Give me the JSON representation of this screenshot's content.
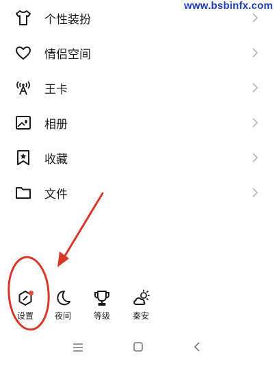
{
  "watermark": "www.bsbinfx.com",
  "menu": {
    "items": [
      {
        "label": "个性装扮",
        "icon": "tshirt-icon"
      },
      {
        "label": "情侣空间",
        "icon": "heart-icon"
      },
      {
        "label": "王卡",
        "icon": "signal-tower-icon"
      },
      {
        "label": "相册",
        "icon": "photo-album-icon"
      },
      {
        "label": "收藏",
        "icon": "bookmark-star-icon"
      },
      {
        "label": "文件",
        "icon": "folder-icon"
      }
    ]
  },
  "tools": [
    {
      "label": "设置",
      "icon": "settings-icon",
      "badge": true
    },
    {
      "label": "夜间",
      "icon": "moon-icon"
    },
    {
      "label": "等级",
      "icon": "trophy-icon"
    },
    {
      "label": "秦安",
      "icon": "weather-icon"
    }
  ],
  "navbar": {
    "buttons": [
      "menu-icon",
      "home-square-icon",
      "back-icon"
    ]
  },
  "colors": {
    "annotation_red": "#d9372a",
    "badge_red": "#e84b3c",
    "icon": "#1a1a1a",
    "chevron": "#b5b5b5"
  }
}
